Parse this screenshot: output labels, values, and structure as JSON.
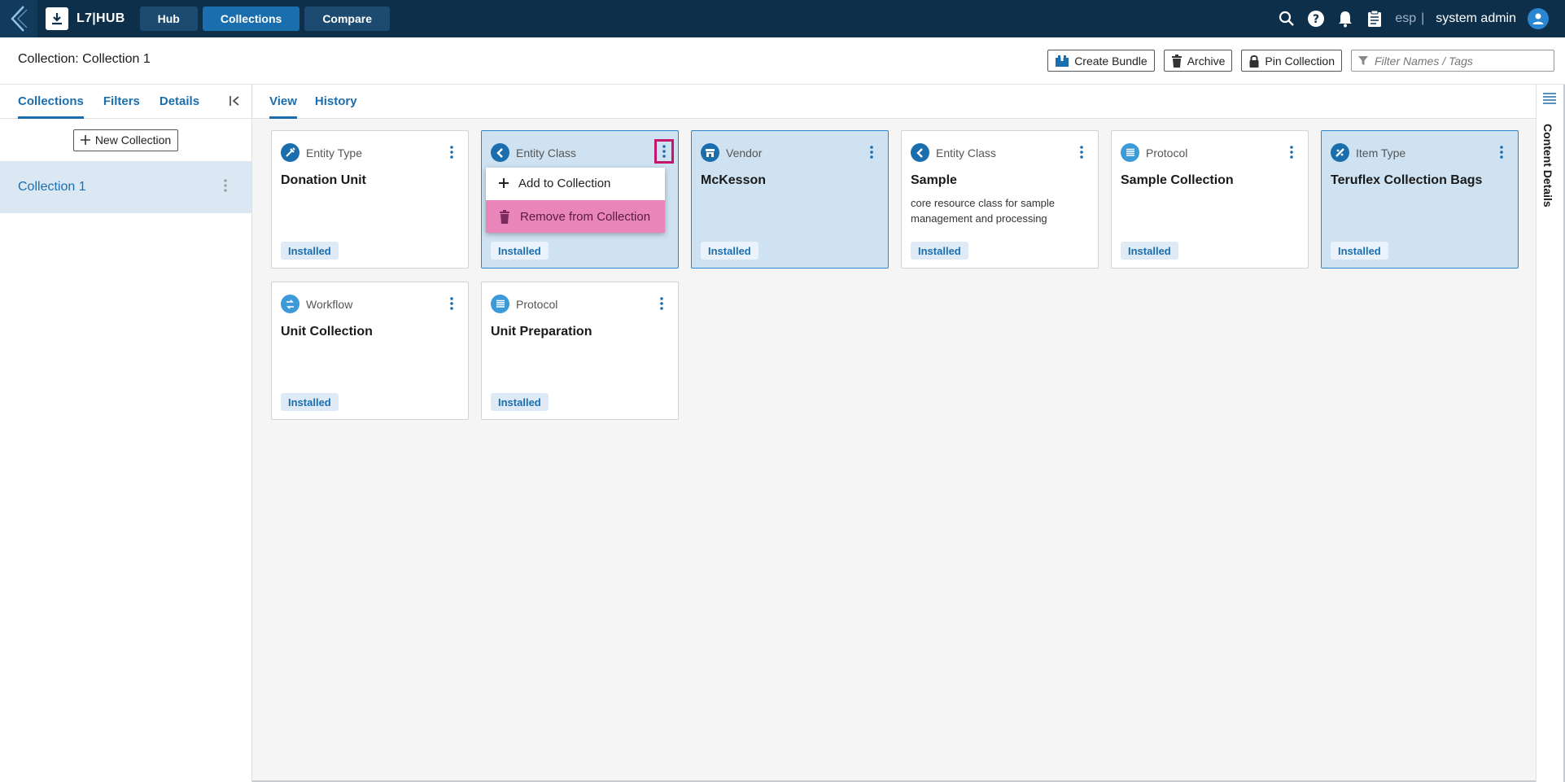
{
  "topbar": {
    "app_name": "L7|HUB",
    "nav": [
      {
        "label": "Hub"
      },
      {
        "label": "Collections"
      },
      {
        "label": "Compare"
      }
    ],
    "lab_code": "esp",
    "separator": "|",
    "user_name": "system admin"
  },
  "header": {
    "title": "Collection: Collection 1",
    "create_bundle": "Create Bundle",
    "archive": "Archive",
    "pin_collection": "Pin Collection",
    "filter_placeholder": "Filter Names / Tags"
  },
  "left_panel": {
    "tabs": [
      "Collections",
      "Filters",
      "Details"
    ],
    "new_collection": "New Collection",
    "collections": [
      {
        "label": "Collection 1"
      }
    ]
  },
  "main": {
    "tabs": [
      "View",
      "History"
    ],
    "cards": [
      {
        "type": "Entity Type",
        "title": "Donation Unit",
        "desc": "",
        "status": "Installed"
      },
      {
        "type": "Entity Class",
        "title": "",
        "desc": "",
        "status": "Installed"
      },
      {
        "type": "Vendor",
        "title": "McKesson",
        "desc": "",
        "status": "Installed"
      },
      {
        "type": "Entity Class",
        "title": "Sample",
        "desc": "core resource class for sample management and processing",
        "status": "Installed"
      },
      {
        "type": "Protocol",
        "title": "Sample Collection",
        "desc": "",
        "status": "Installed"
      },
      {
        "type": "Item Type",
        "title": "Teruflex Collection Bags",
        "desc": "",
        "status": "Installed"
      },
      {
        "type": "Workflow",
        "title": "Unit Collection",
        "desc": "",
        "status": "Installed"
      },
      {
        "type": "Protocol",
        "title": "Unit Preparation",
        "desc": "",
        "status": "Installed"
      }
    ],
    "context_menu": {
      "add": "Add to Collection",
      "remove": "Remove from Collection"
    }
  },
  "right_rail": {
    "label": "Content Details"
  },
  "colors": {
    "topbar": "#0d2f4a",
    "accent": "#1b6eae",
    "selected_card": "#cfe2f1",
    "danger_menu": "#e985b8",
    "focus_ring": "#c3166d"
  }
}
